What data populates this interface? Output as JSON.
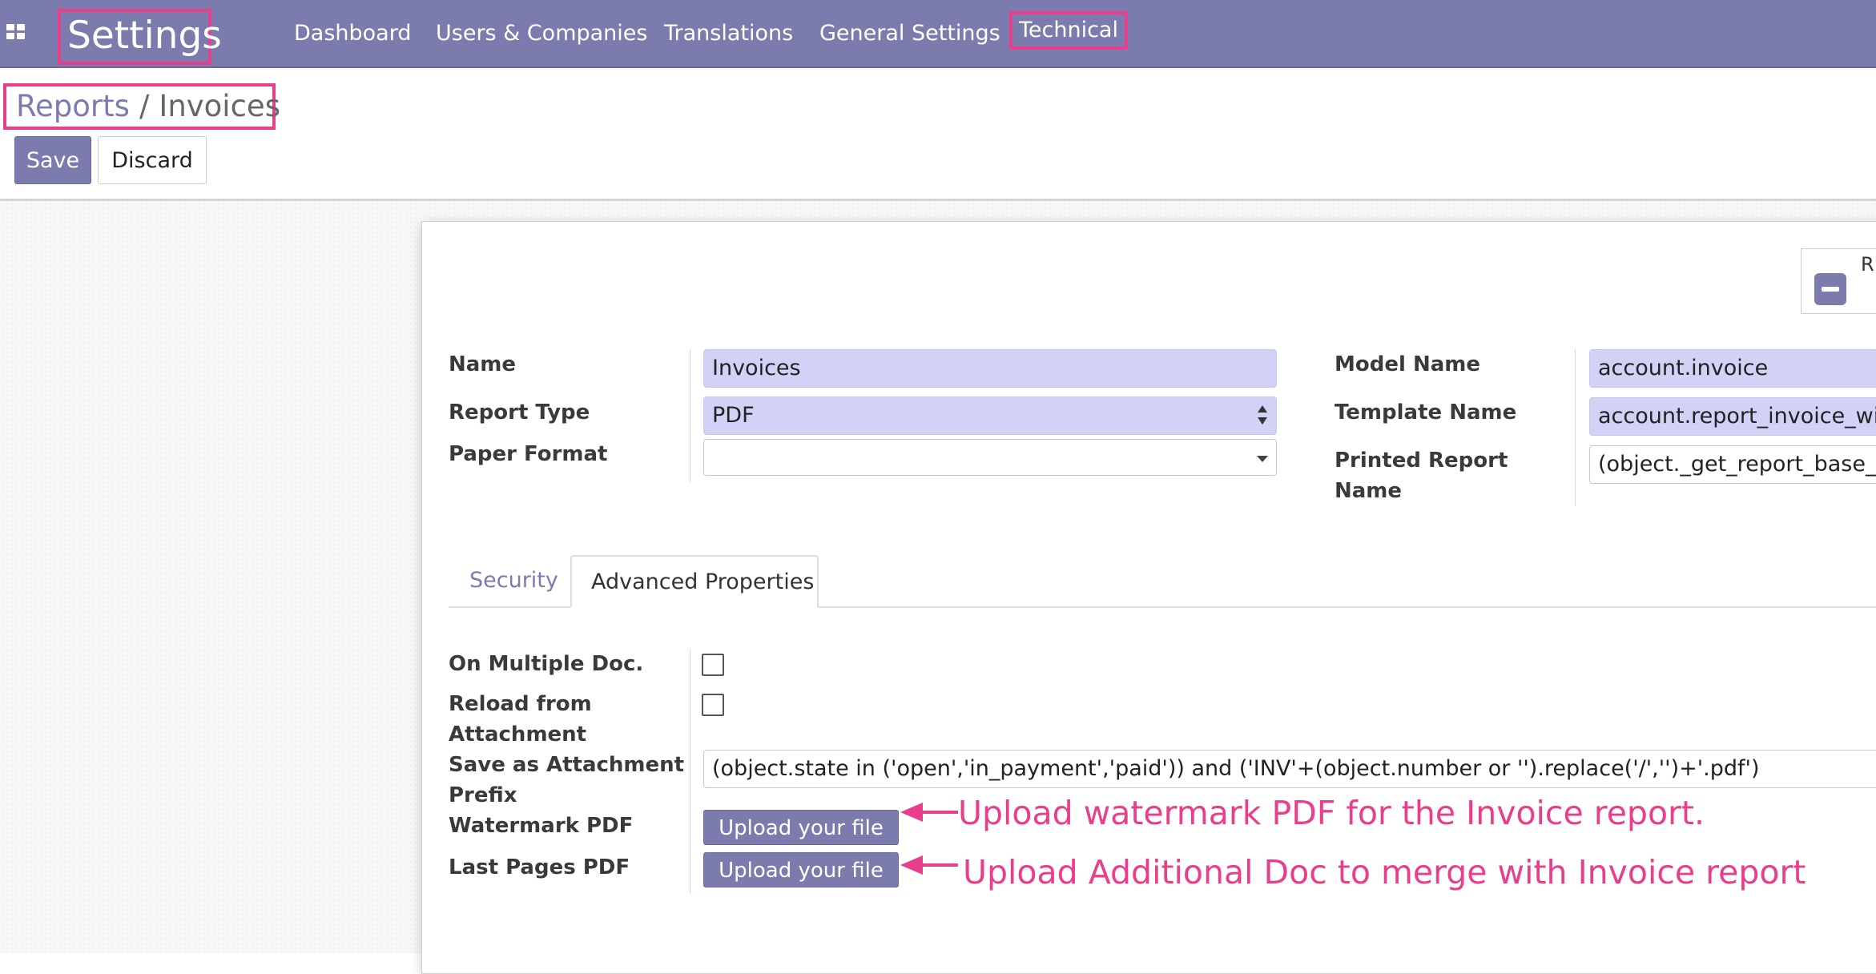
{
  "navbar": {
    "brand": "Settings",
    "menu": [
      "Dashboard",
      "Users & Companies",
      "Translations",
      "General Settings",
      "Technical"
    ]
  },
  "breadcrumb": {
    "parent": "Reports",
    "separator": "/",
    "current": "Invoices"
  },
  "buttons": {
    "save": "Save",
    "discard": "Discard"
  },
  "status_box": {
    "text": "R th m"
  },
  "fields": {
    "name": {
      "label": "Name",
      "value": "Invoices"
    },
    "report_type": {
      "label": "Report Type",
      "value": "PDF"
    },
    "paper_format": {
      "label": "Paper Format",
      "value": ""
    },
    "model_name": {
      "label": "Model Name",
      "value": "account.invoice"
    },
    "template_name": {
      "label": "Template Name",
      "value": "account.report_invoice_with"
    },
    "printed_report_name": {
      "label_line1": "Printed Report",
      "label_line2": "Name",
      "value": "(object._get_report_base_fil"
    }
  },
  "tabs": [
    "Security",
    "Advanced Properties"
  ],
  "advanced": {
    "on_multiple_doc": {
      "label": "On Multiple Doc.",
      "checked": false
    },
    "reload_from_attachment": {
      "label_line1": "Reload from",
      "label_line2": "Attachment",
      "checked": false
    },
    "save_as_attachment_prefix": {
      "label_line1": "Save as Attachment",
      "label_line2": "Prefix",
      "value": "(object.state in ('open','in_payment','paid')) and ('INV'+(object.number or '').replace('/','')+'.pdf')"
    },
    "watermark_pdf": {
      "label": "Watermark PDF",
      "button": "Upload your file"
    },
    "last_pages_pdf": {
      "label": "Last Pages PDF",
      "button": "Upload your file"
    }
  },
  "annotations": {
    "watermark": "Upload watermark PDF for the Invoice report.",
    "last_pages": "Upload Additional Doc to merge with Invoice report"
  },
  "colors": {
    "primary": "#7c7bad",
    "highlight": "#e83e8c",
    "field_bg": "#d2d2f7"
  }
}
